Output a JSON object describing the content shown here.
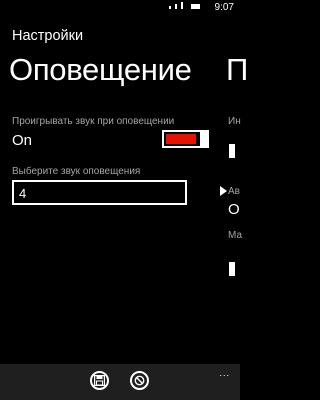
{
  "status_bar": {
    "time": "9:07",
    "icons": [
      "signal-icon",
      "battery-icon"
    ]
  },
  "app_title": "Настройки",
  "pivot": {
    "current": "Оповещение",
    "next_peek": "П"
  },
  "settings": {
    "play_sound_label": "Проигрывать звук при оповещении",
    "play_sound_value": "On",
    "toggle_on": true,
    "choose_sound_label": "Выберите звук оповещения",
    "choose_sound_value": "4"
  },
  "peek": {
    "label1": "Ин",
    "label2": "Ав",
    "value2": "О",
    "label3": "Ма"
  },
  "app_bar": {
    "buttons": [
      "save-icon",
      "cancel-icon"
    ],
    "more": "..."
  },
  "colors": {
    "accent": "#e51400",
    "background": "#000000",
    "appbar": "#1f1f1f"
  }
}
